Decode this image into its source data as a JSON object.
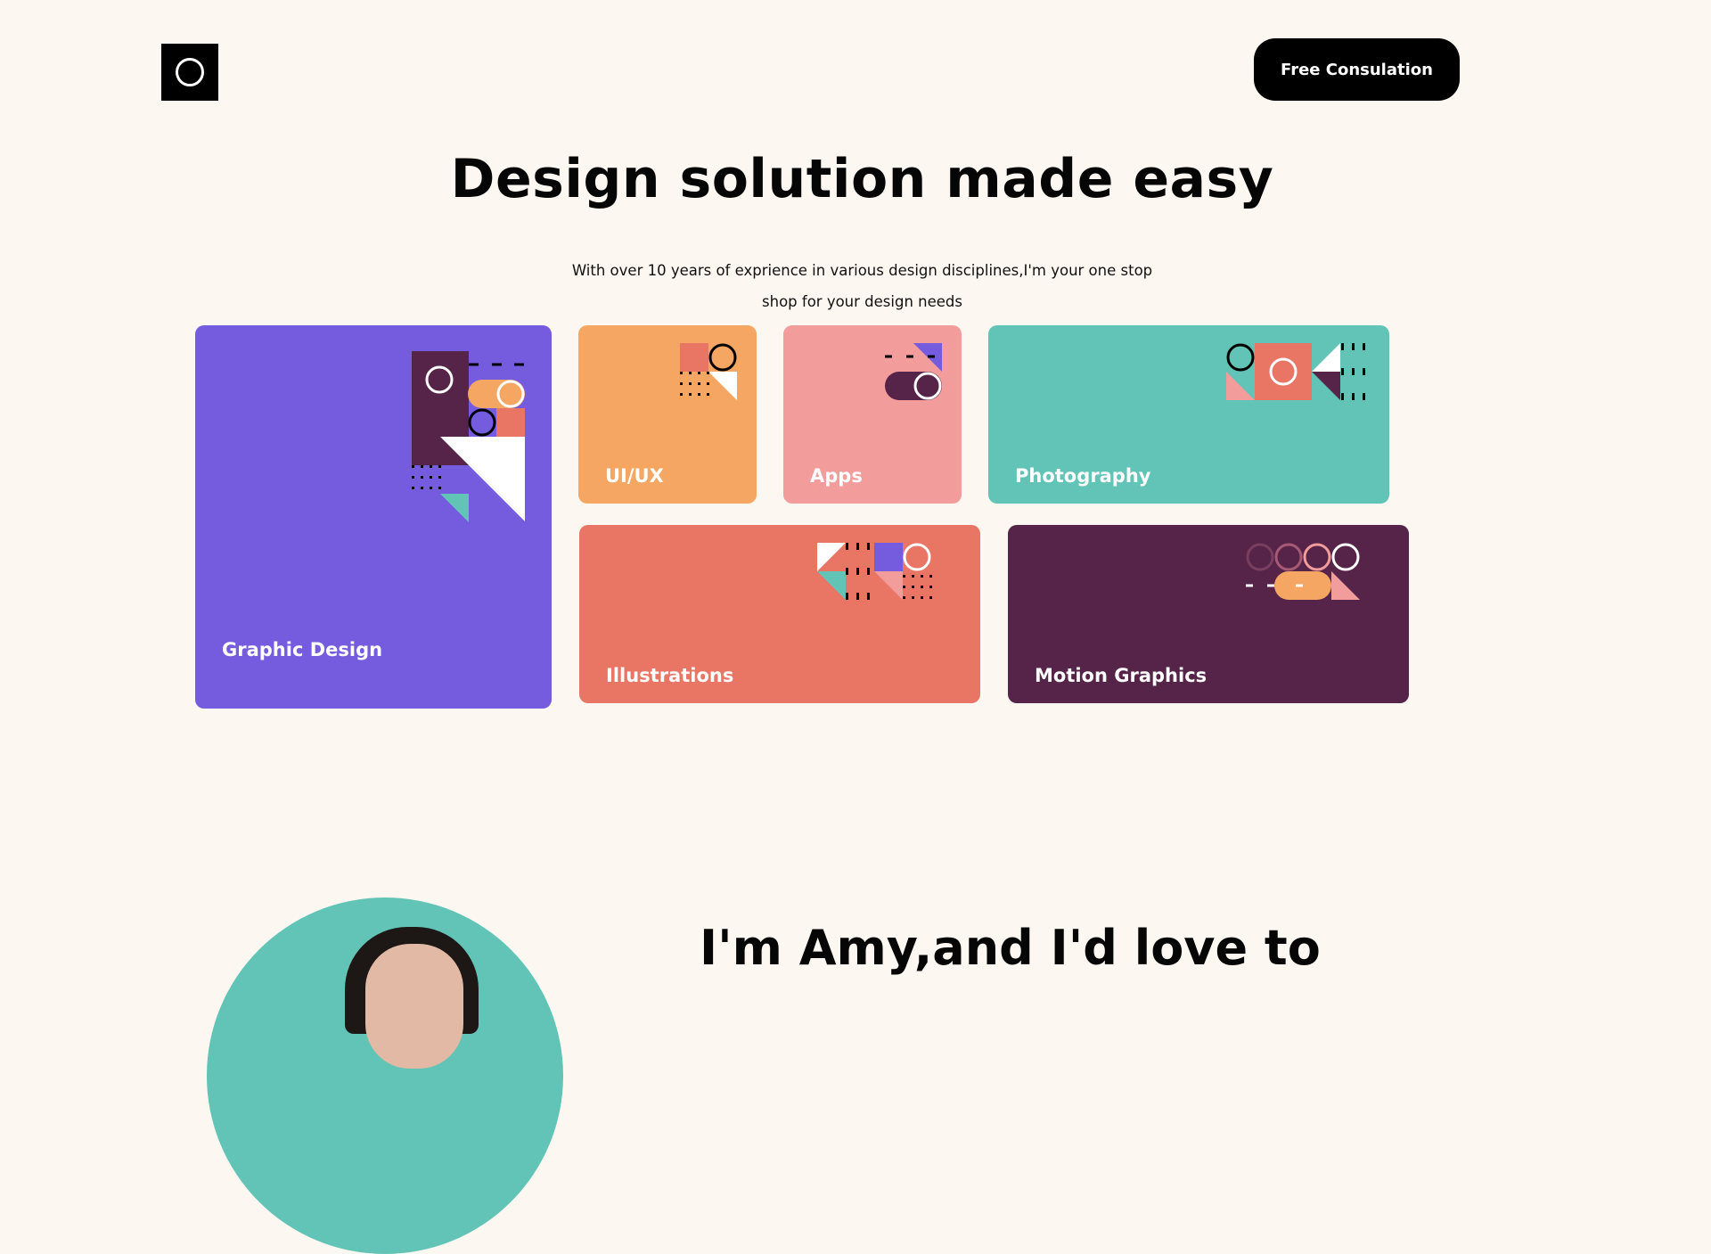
{
  "header": {
    "logo_icon": "ring-logo-icon",
    "cta_label": "Free Consulation"
  },
  "hero": {
    "title": "Design solution made easy",
    "subtitle": "With over 10 years of exprience in various design disciplines,I'm your one stop shop for your design needs"
  },
  "services": [
    {
      "label": "Graphic Design",
      "color": "#755cde"
    },
    {
      "label": "UI/UX",
      "color": "#f4a662"
    },
    {
      "label": "Apps",
      "color": "#f29c9b"
    },
    {
      "label": "Photography",
      "color": "#62c4b7"
    },
    {
      "label": "Illustrations",
      "color": "#e97565"
    },
    {
      "label": "Motion Graphics",
      "color": "#552448"
    }
  ],
  "about": {
    "title": "I'm Amy,and I'd love to",
    "portrait_bg": "#62c4b7"
  }
}
